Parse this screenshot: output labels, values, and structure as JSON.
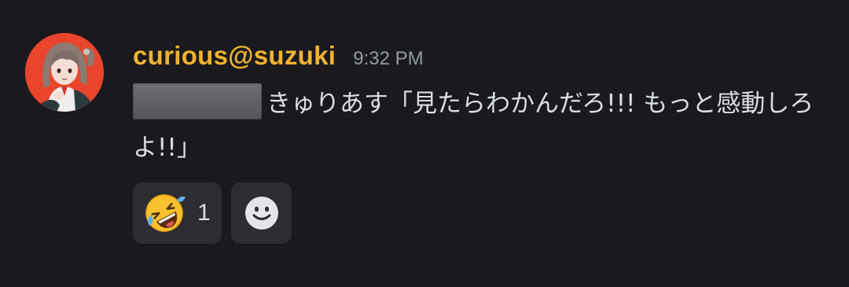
{
  "message": {
    "author": {
      "name": "curious@suzuki",
      "name_color": "#f0b232",
      "avatar_icon": "anime-girl-avatar"
    },
    "timestamp": "9:32 PM",
    "body_text": "きゅりあす「見たらわかんだろ!!! もっと感動しろよ!!」",
    "redacted_prefix": true,
    "reactions": [
      {
        "emoji_icon": "rolling-on-floor-laughing-emoji",
        "count": "1"
      }
    ],
    "add_reaction_icon": "smiley-icon"
  },
  "colors": {
    "background": "#1a1a1e",
    "reaction_background": "#2b2d31",
    "text": "#dbdee1",
    "timestamp": "#949ba4"
  }
}
